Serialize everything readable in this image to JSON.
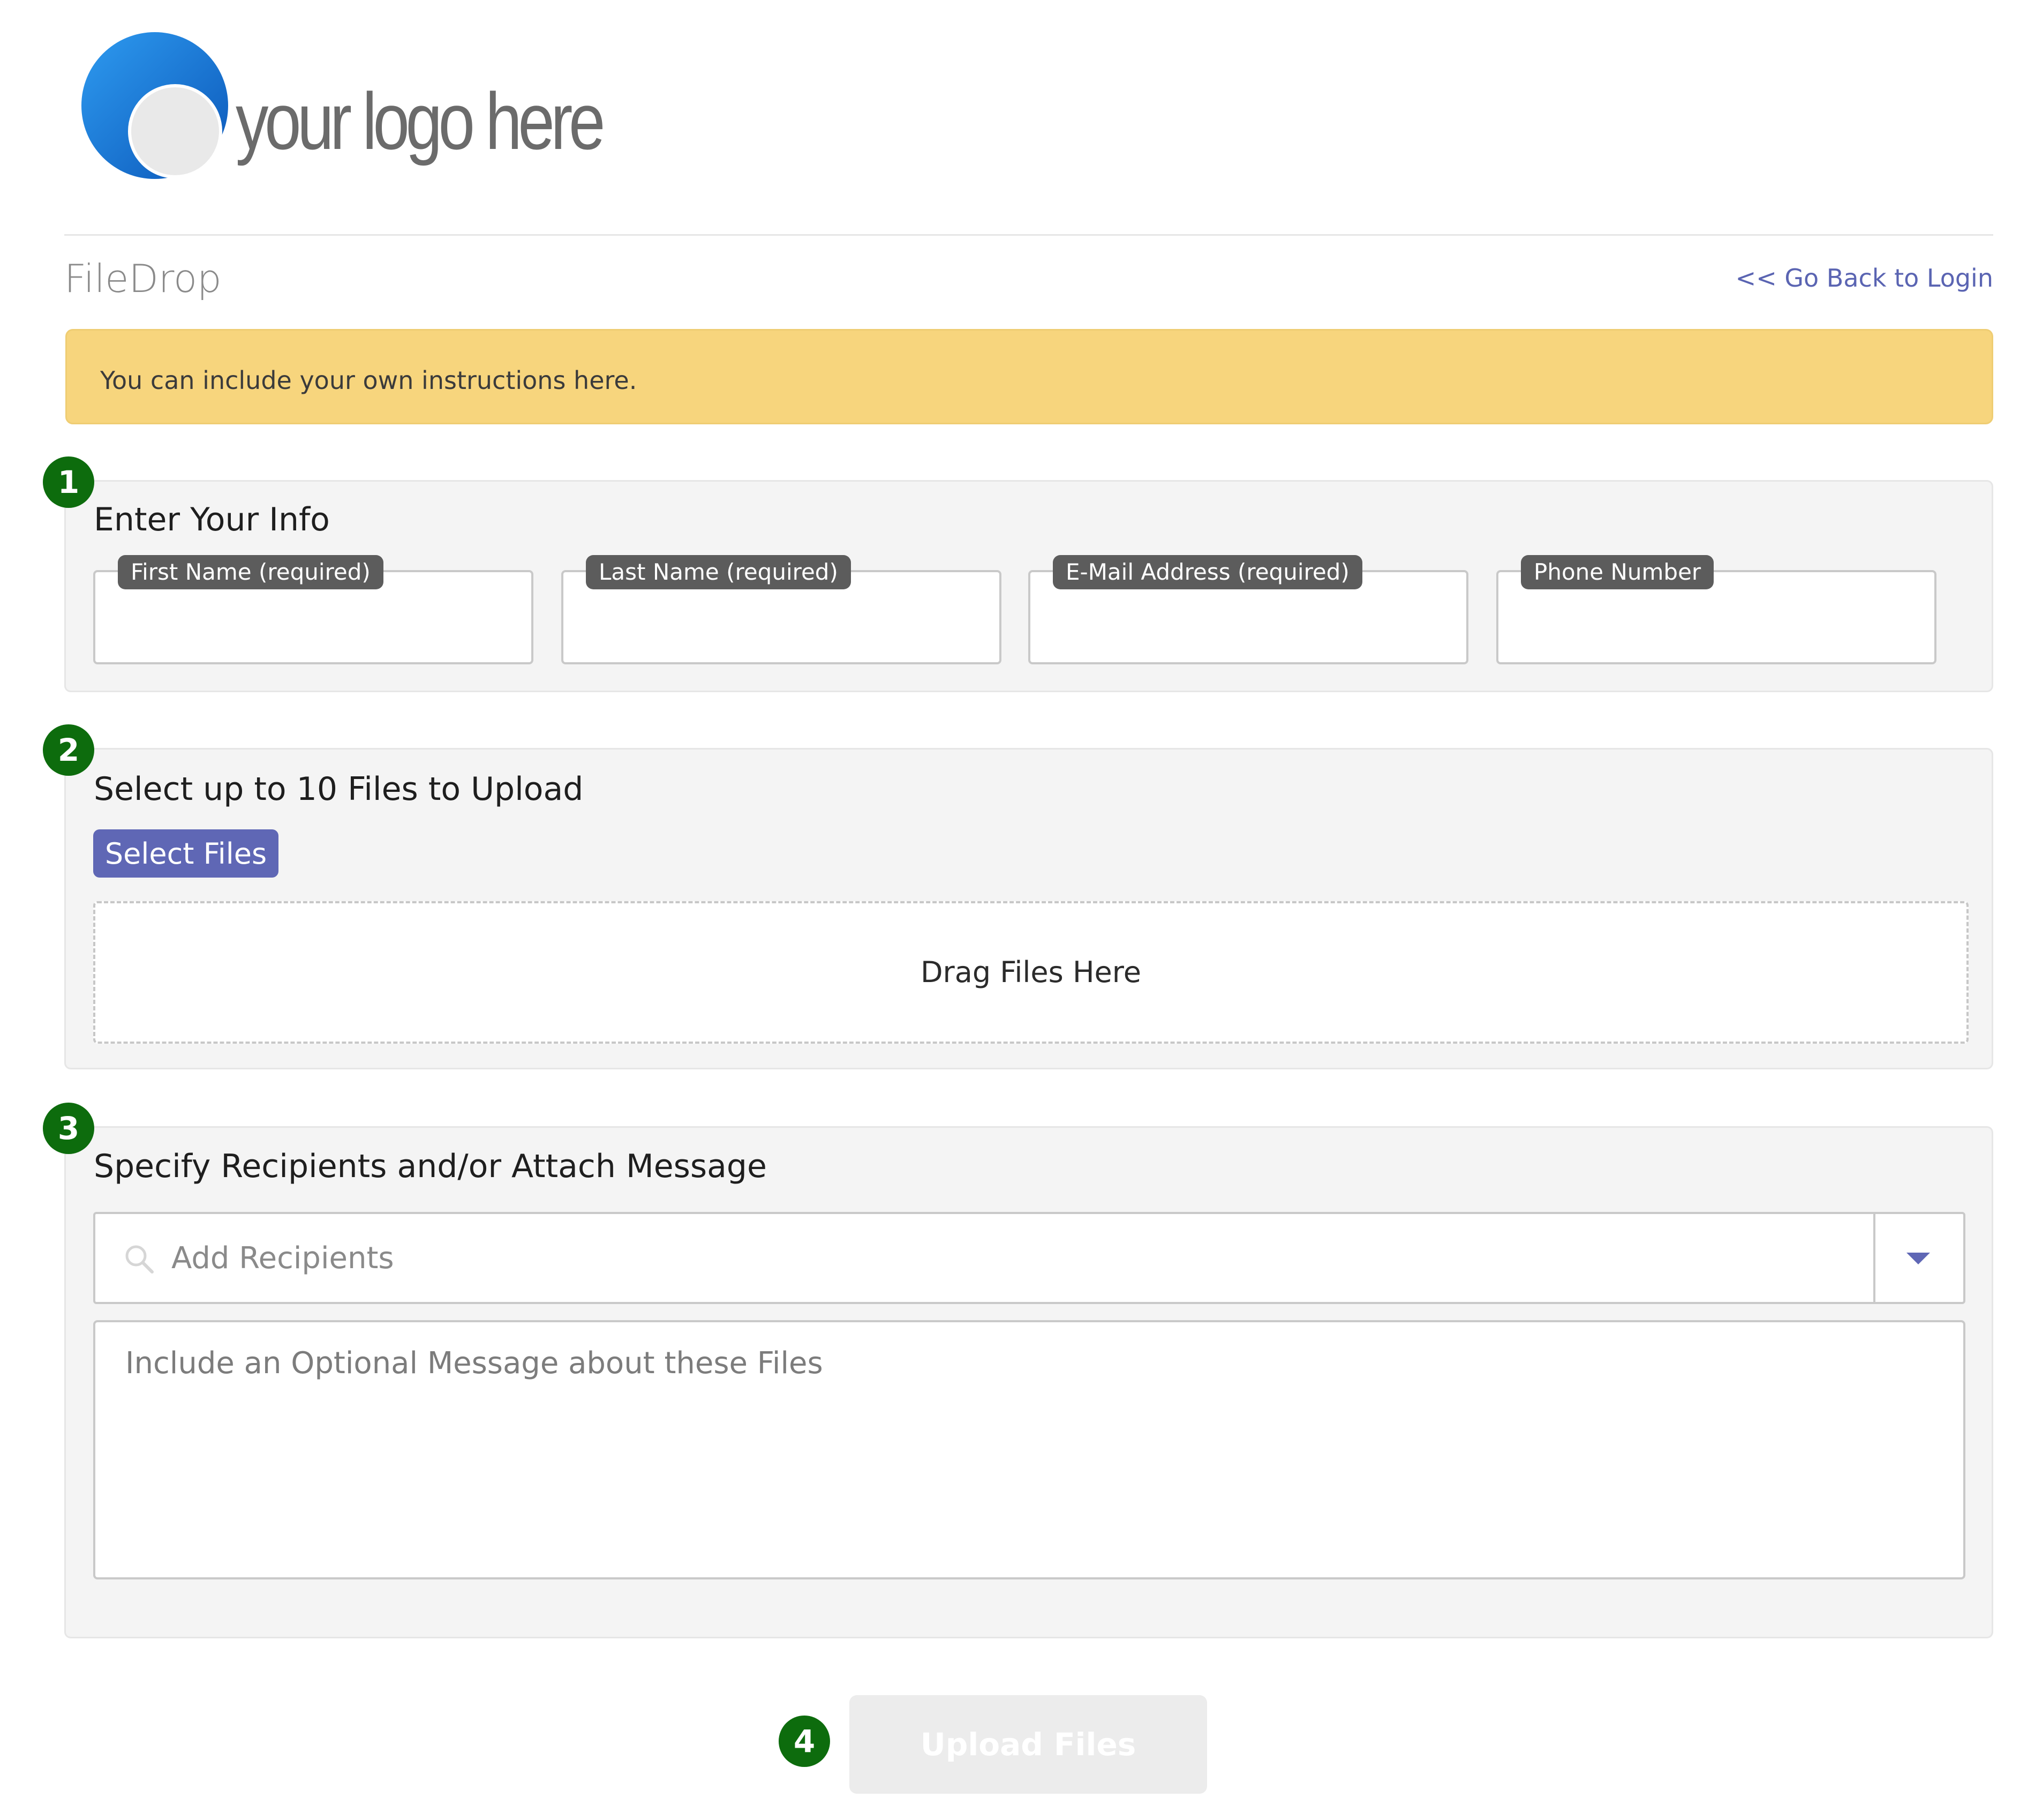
{
  "logo": {
    "text": "your logo here"
  },
  "header": {
    "title": "FileDrop",
    "back_link": "<< Go Back to Login"
  },
  "banner": {
    "text": "You can include your own instructions here."
  },
  "step_numbers": [
    "1",
    "2",
    "3",
    "4"
  ],
  "section_info": {
    "heading": "Enter Your Info",
    "fields": [
      {
        "label": "First Name (required)",
        "value": ""
      },
      {
        "label": "Last Name (required)",
        "value": ""
      },
      {
        "label": "E-Mail Address (required)",
        "value": ""
      },
      {
        "label": "Phone Number",
        "value": ""
      }
    ]
  },
  "section_files": {
    "heading": "Select up to 10 Files to Upload",
    "select_button": "Select Files",
    "dropzone_text": "Drag Files Here"
  },
  "section_recipients": {
    "heading": "Specify Recipients and/or Attach Message",
    "recipients_placeholder": "Add Recipients",
    "message_placeholder": "Include an Optional Message about these Files"
  },
  "upload_button": "Upload Files",
  "colors": {
    "accent": "#5f67b5",
    "banner": "#f7d57d",
    "step_badge": "#0d6c0d",
    "label_badge": "#5c5c5c",
    "panel": "#f4f4f4"
  }
}
